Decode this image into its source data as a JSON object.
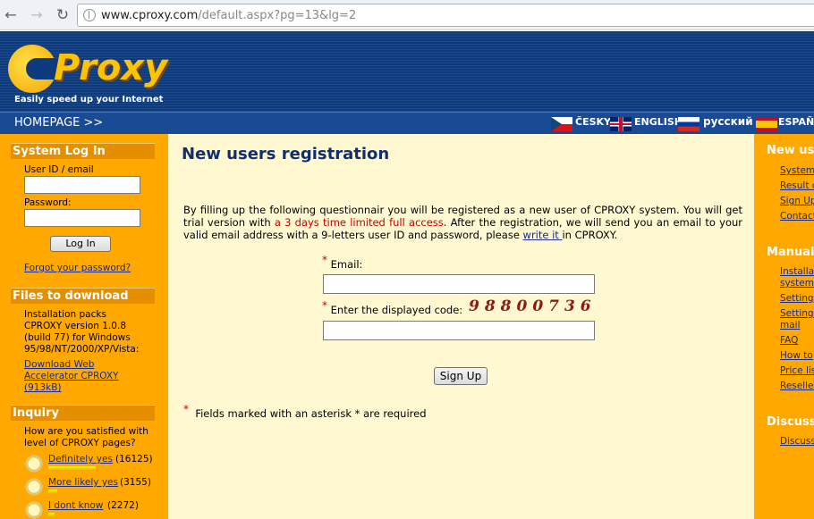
{
  "browser": {
    "url_host": "www.cproxy.com",
    "url_rest": "/default.aspx?pg=13&lg=2"
  },
  "header": {
    "logo_text": "Proxy",
    "tagline": "Easily speed up your Internet"
  },
  "navbar": {
    "homepage": "HOMEPAGE >>",
    "languages": [
      "ČESKY",
      "ENGLISH",
      "русский",
      "ESPAÑOL"
    ]
  },
  "left": {
    "login_title": "System Log In",
    "userid_label": "User ID / email",
    "password_label": "Password:",
    "login_button": "Log In",
    "forgot": "Forgot your password?",
    "files_title": "Files to download",
    "files_text": "Installation packs CPROXY version 1.0.8 (build 77) for Windows 95/98/NT/2000/XP/Vista:",
    "download_link": "Download Web Accelerator CPROXY (913kB)",
    "inquiry_title": "Inquiry",
    "inquiry_question": "How are you satisfied with level of CPROXY pages?",
    "votes": [
      {
        "label": "Definitely yes",
        "count": "(16125)",
        "share": 0.78
      },
      {
        "label": "More likely yes",
        "count": "(3155)",
        "share": 0.15
      },
      {
        "label": "I dont know",
        "count": "(2272)",
        "share": 0.11
      }
    ]
  },
  "main": {
    "title": "New users registration",
    "intro_1": "By filling up the following questionnair you will be registered as a new user of CPROXY system. You will get trial version with ",
    "intro_red": "a 3 days time limited full access",
    "intro_2": ". After the registration, we will send you an email to your valid email address with a 9-letters user ID and password, please ",
    "intro_link": "write it ",
    "intro_3": "in CPROXY.",
    "email_label": "Email:",
    "code_label": "Enter the displayed code:",
    "captcha": "98800736",
    "signup_button": "Sign Up",
    "required_note": "Fields marked with an asterisk * are required"
  },
  "right": {
    "section1_title": "New use",
    "section1_links": [
      "System",
      "Result c",
      "Sign Up",
      "Contact"
    ],
    "section2_title": "Manuals",
    "section2_links": [
      "Installat",
      "system",
      "Setting",
      "Settings",
      "mail",
      "FAQ",
      "How to",
      "Price list",
      "Reseller"
    ],
    "section3_title": "Discussi",
    "section3_links": [
      "Discussi"
    ]
  }
}
